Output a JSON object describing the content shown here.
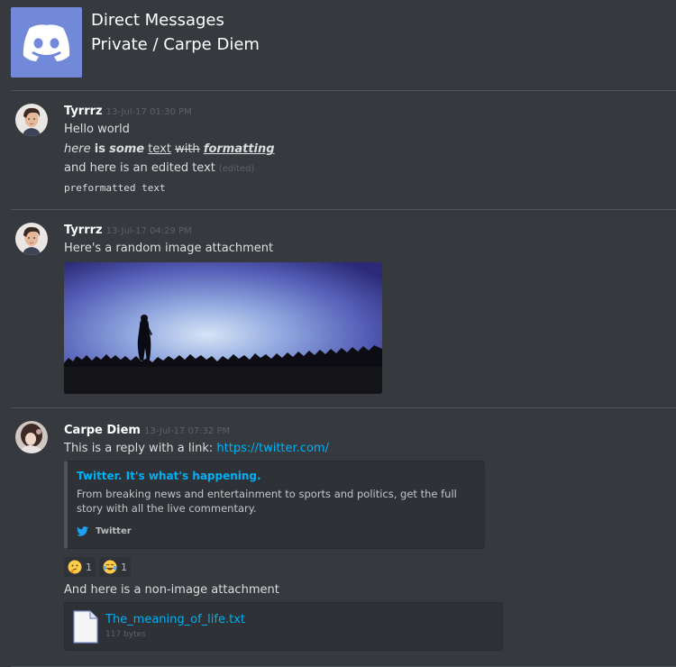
{
  "header": {
    "title": "Direct Messages",
    "subtitle": "Private / Carpe Diem",
    "logo_icon": "discord-logo-icon",
    "logo_color": "#7289da"
  },
  "groups": [
    {
      "author": "Tyrrrz",
      "timestamp": "13-Jul-17 01:30 PM",
      "messages": {
        "line1": "Hello world",
        "line2": {
          "italic": "here",
          "bold": "is",
          "bold_italic": "some",
          "underline": "text",
          "strike": "with",
          "bold_italic_underline": "formatting"
        },
        "line3": "and here is an edited text",
        "edited_label": "(edited)",
        "line4": "preformatted text"
      }
    },
    {
      "author": "Tyrrrz",
      "timestamp": "13-Jul-17 04:29 PM",
      "messages": {
        "line1": "Here's a random image attachment"
      }
    },
    {
      "author": "Carpe Diem",
      "timestamp": "13-Jul-17 07:32 PM",
      "messages": {
        "line1_text": "This is a reply with a link:",
        "line1_link": "https://twitter.com/",
        "embed": {
          "title": "Twitter. It's what's happening.",
          "description": "From breaking news and entertainment to sports and politics, get the full story with all the live commentary.",
          "footer": "Twitter"
        },
        "reactions": [
          {
            "emoji": "thinking-face",
            "count": "1"
          },
          {
            "emoji": "tears-of-joy",
            "count": "1"
          }
        ],
        "line2": "And here is a non-image attachment",
        "file": {
          "name": "The_meaning_of_life.txt",
          "size": "117 bytes"
        }
      }
    }
  ]
}
